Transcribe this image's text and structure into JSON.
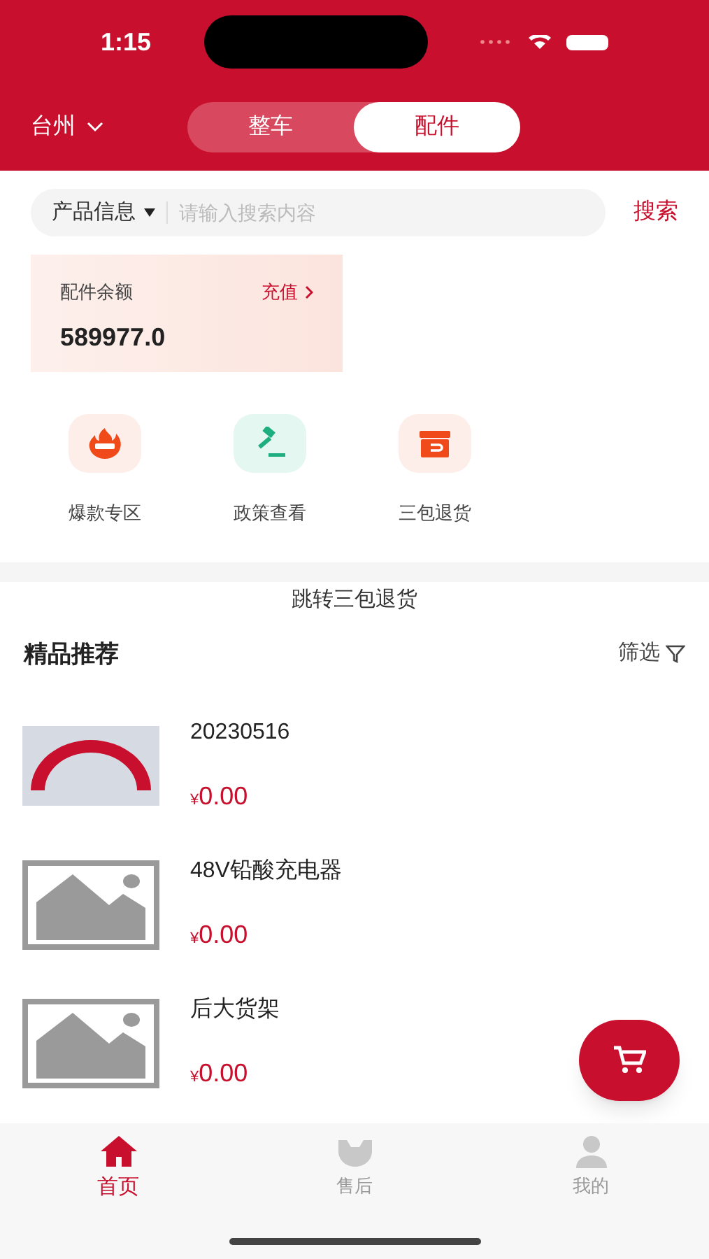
{
  "status_bar": {
    "time": "1:15"
  },
  "header": {
    "city": "台州",
    "tabs": [
      {
        "label": "整车",
        "selected": false
      },
      {
        "label": "配件",
        "selected": true
      }
    ]
  },
  "search": {
    "category": "产品信息",
    "placeholder": "请输入搜索内容",
    "button": "搜索"
  },
  "balance": {
    "label": "配件余额",
    "action": "充值",
    "amount": "589977.0"
  },
  "shortcuts": [
    {
      "kind": "hot",
      "label": "爆款专区"
    },
    {
      "kind": "policy",
      "label": "政策查看"
    },
    {
      "kind": "return",
      "label": "三包退货"
    }
  ],
  "notice": "跳转三包退货",
  "section": {
    "title": "精品推荐",
    "filter": "筛选"
  },
  "products": [
    {
      "kind": "picture",
      "name": "20230516",
      "price": "0.00",
      "currency": "¥"
    },
    {
      "kind": "placeholder",
      "name": "48V铅酸充电器",
      "price": "0.00",
      "currency": "¥"
    },
    {
      "kind": "placeholder",
      "name": "后大货架",
      "price": "0.00",
      "currency": "¥"
    }
  ],
  "tab_bar": [
    {
      "kind": "home",
      "label": "首页",
      "selected": true
    },
    {
      "kind": "service",
      "label": "售后",
      "selected": false
    },
    {
      "kind": "profile",
      "label": "我的",
      "selected": false
    }
  ]
}
